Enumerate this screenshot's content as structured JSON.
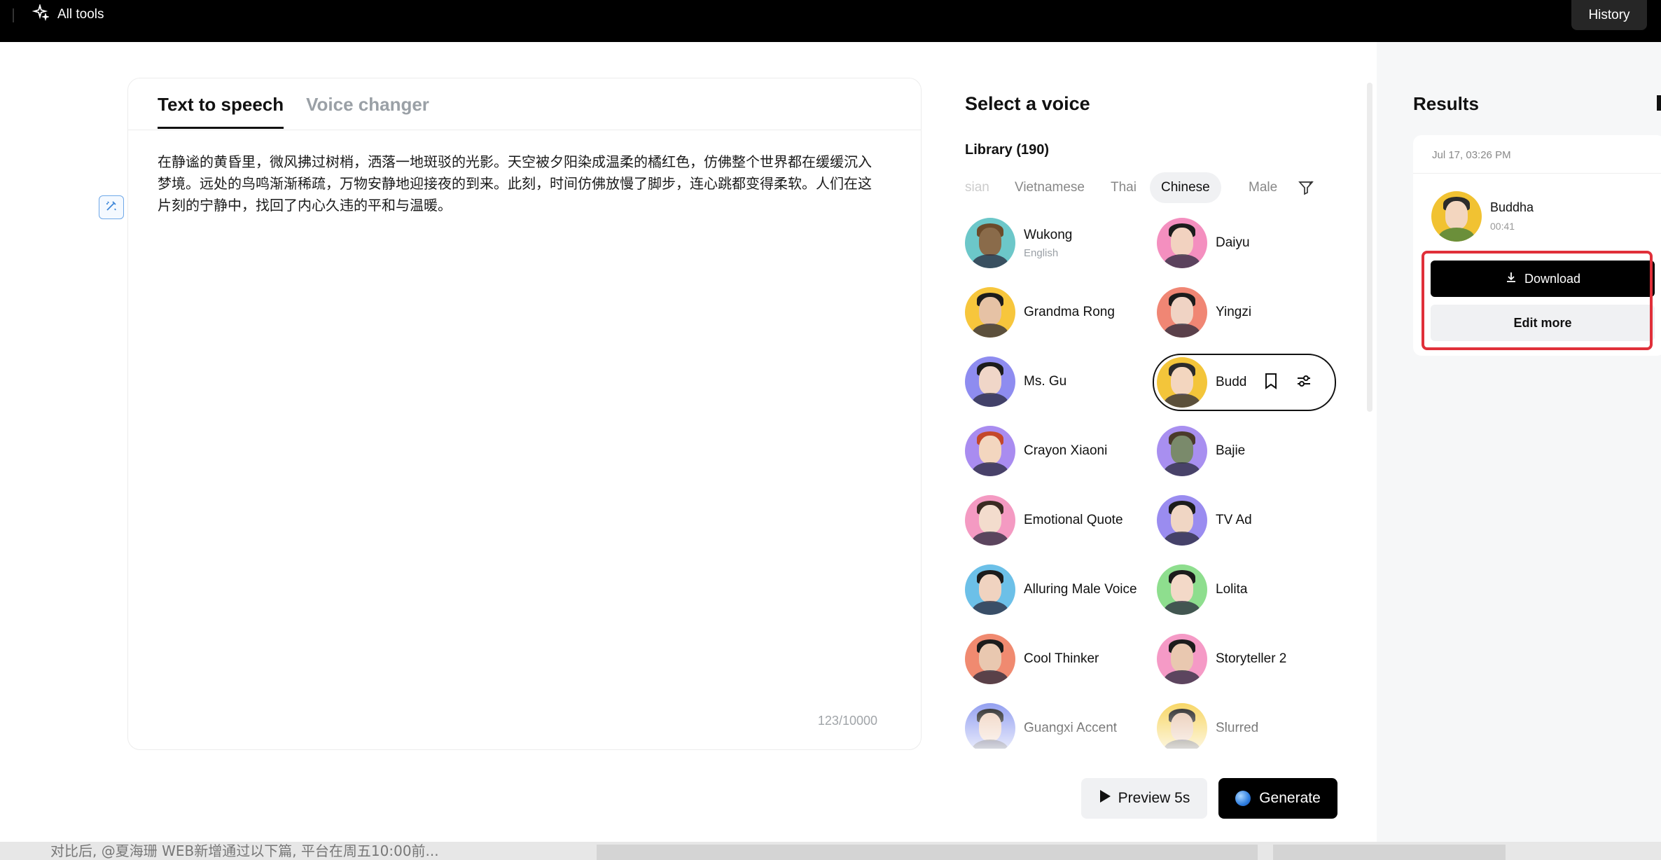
{
  "topbar": {
    "all_tools": "All tools",
    "history": "History"
  },
  "editor": {
    "tabs": [
      {
        "label": "Text to speech"
      },
      {
        "label": "Voice changer"
      }
    ],
    "text": "在静谧的黄昏里，微风拂过树梢，洒落一地斑驳的光影。天空被夕阳染成温柔的橘红色，仿佛整个世界都在缓缓沉入梦境。远处的鸟鸣渐渐稀疏，万物安静地迎接夜的到来。此刻，时间仿佛放慢了脚步，连心跳都变得柔软。人们在这片刻的宁静中，找回了内心久违的平和与温暖。",
    "char_count": "123/10000"
  },
  "voice_panel": {
    "title": "Select a voice",
    "library": "Library (190)",
    "filters": [
      "sian",
      "Vietnamese",
      "Thai",
      "Chinese",
      "Male"
    ],
    "selected_filter": "Chinese",
    "voices": [
      {
        "name": "Wukong",
        "sub": "English",
        "bg": "#6cc7c9",
        "skin": "#8a6b4a",
        "hair": "#6b4a2a"
      },
      {
        "name": "Daiyu",
        "sub": "",
        "bg": "#f48fbf",
        "skin": "#f2d2c0",
        "hair": "#1c1c1c"
      },
      {
        "name": "Grandma Rong",
        "sub": "",
        "bg": "#f7c63c",
        "skin": "#e6c2a5",
        "hair": "#1c1c1c"
      },
      {
        "name": "Yingzi",
        "sub": "",
        "bg": "#f08674",
        "skin": "#f0d3c4",
        "hair": "#1c1c1c"
      },
      {
        "name": "Ms. Gu",
        "sub": "",
        "bg": "#8e8cf0",
        "skin": "#f0d6c8",
        "hair": "#1c1c1c"
      },
      {
        "name": "Buddha",
        "sub": "",
        "bg": "#f3c53a",
        "skin": "#f3d6bf",
        "hair": "#2b2b2b",
        "selected": true
      },
      {
        "name": "Crayon Xiaoni",
        "sub": "",
        "bg": "#a98cf0",
        "skin": "#f3d6bf",
        "hair": "#c4472a"
      },
      {
        "name": "Bajie",
        "sub": "",
        "bg": "#a88ff0",
        "skin": "#7a8a6b",
        "hair": "#4a3a2a"
      },
      {
        "name": "Emotional Quote",
        "sub": "",
        "bg": "#f49ac2",
        "skin": "#f3dccd",
        "hair": "#3a2a22"
      },
      {
        "name": "TV Ad",
        "sub": "",
        "bg": "#9a8cf0",
        "skin": "#f0d6c4",
        "hair": "#1c1c1c"
      },
      {
        "name": "Alluring Male Voice",
        "sub": "",
        "bg": "#6cc0e8",
        "skin": "#f0d3c0",
        "hair": "#1c1c1c"
      },
      {
        "name": "Lolita",
        "sub": "",
        "bg": "#8ede8e",
        "skin": "#f3d9c8",
        "hair": "#1c1c1c"
      },
      {
        "name": "Cool Thinker",
        "sub": "",
        "bg": "#f08a70",
        "skin": "#e9c8b0",
        "hair": "#1c1c1c"
      },
      {
        "name": "Storyteller 2",
        "sub": "",
        "bg": "#f59ac6",
        "skin": "#e9c8b0",
        "hair": "#1c1c1c"
      },
      {
        "name": "Guangxi Accent",
        "sub": "",
        "bg": "#8f9cf0",
        "skin": "#f0d3c0",
        "hair": "#1c1c1c"
      },
      {
        "name": "Slurred",
        "sub": "",
        "bg": "#f7d560",
        "skin": "#e9c8b0",
        "hair": "#1c1c1c"
      }
    ]
  },
  "buttons": {
    "preview": "Preview 5s",
    "generate": "Generate"
  },
  "results": {
    "title": "Results",
    "date": "Jul 17, 03:26 PM",
    "voice_name": "Buddha",
    "duration": "00:41",
    "download": "Download",
    "edit_more": "Edit more"
  },
  "taskbar": {
    "text": "对比后, @夏海珊 WEB新增通过以下篇, 平台在周五10:00前..."
  },
  "colors": {
    "accent": "#000000",
    "highlight": "#e0303a",
    "panel_bg": "#f6f7f8"
  }
}
